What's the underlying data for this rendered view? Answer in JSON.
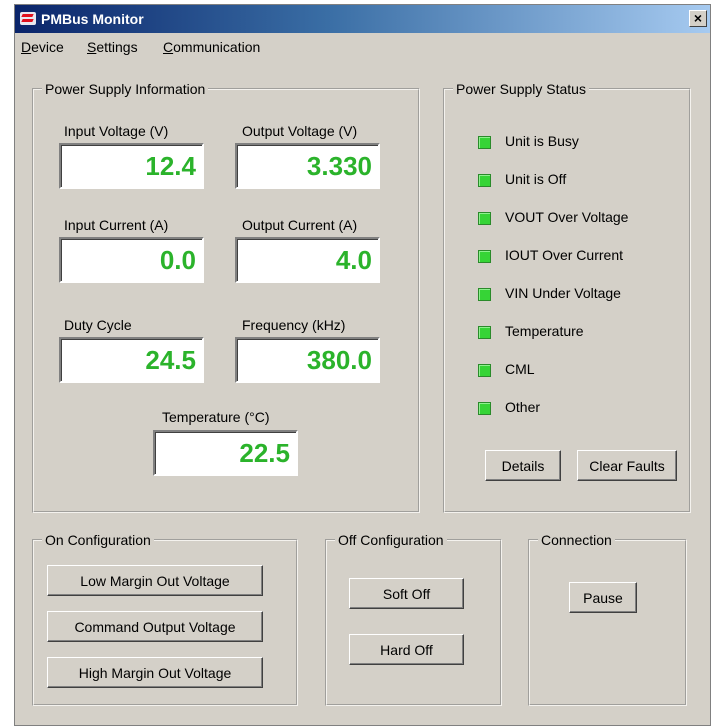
{
  "window": {
    "title": "PMBus Monitor",
    "close_glyph": "×"
  },
  "menu": [
    {
      "accel": "D",
      "rest": "evice"
    },
    {
      "accel": "S",
      "rest": "ettings"
    },
    {
      "accel": "C",
      "rest": "ommunication"
    }
  ],
  "info": {
    "legend": "Power Supply Information",
    "fields": [
      {
        "label": "Input Voltage (V)",
        "value": "12.4"
      },
      {
        "label": "Output Voltage (V)",
        "value": "3.330"
      },
      {
        "label": "Input Current (A)",
        "value": "0.0"
      },
      {
        "label": "Output Current (A)",
        "value": "4.0"
      },
      {
        "label": "Duty Cycle",
        "value": "24.5"
      },
      {
        "label": "Frequency (kHz)",
        "value": "380.0"
      },
      {
        "label": "Temperature (°C)",
        "value": "22.5"
      }
    ],
    "value_color": "#2bb32b"
  },
  "status": {
    "legend": "Power Supply Status",
    "items": [
      {
        "label": "Unit is Busy",
        "state": "ok"
      },
      {
        "label": "Unit is Off",
        "state": "ok"
      },
      {
        "label": "VOUT Over Voltage",
        "state": "ok"
      },
      {
        "label": "IOUT Over Current",
        "state": "ok"
      },
      {
        "label": "VIN Under Voltage",
        "state": "ok"
      },
      {
        "label": "Temperature",
        "state": "ok"
      },
      {
        "label": "CML",
        "state": "ok"
      },
      {
        "label": "Other",
        "state": "ok"
      }
    ],
    "led_color": "#36d436",
    "details_label": "Details",
    "clear_label": "Clear Faults"
  },
  "on_config": {
    "legend": "On Configuration",
    "buttons": [
      "Low Margin Out Voltage",
      "Command Output Voltage",
      "High Margin Out Voltage"
    ]
  },
  "off_config": {
    "legend": "Off Configuration",
    "buttons": [
      "Soft Off",
      "Hard Off"
    ]
  },
  "connection": {
    "legend": "Connection",
    "pause_label": "Pause"
  }
}
